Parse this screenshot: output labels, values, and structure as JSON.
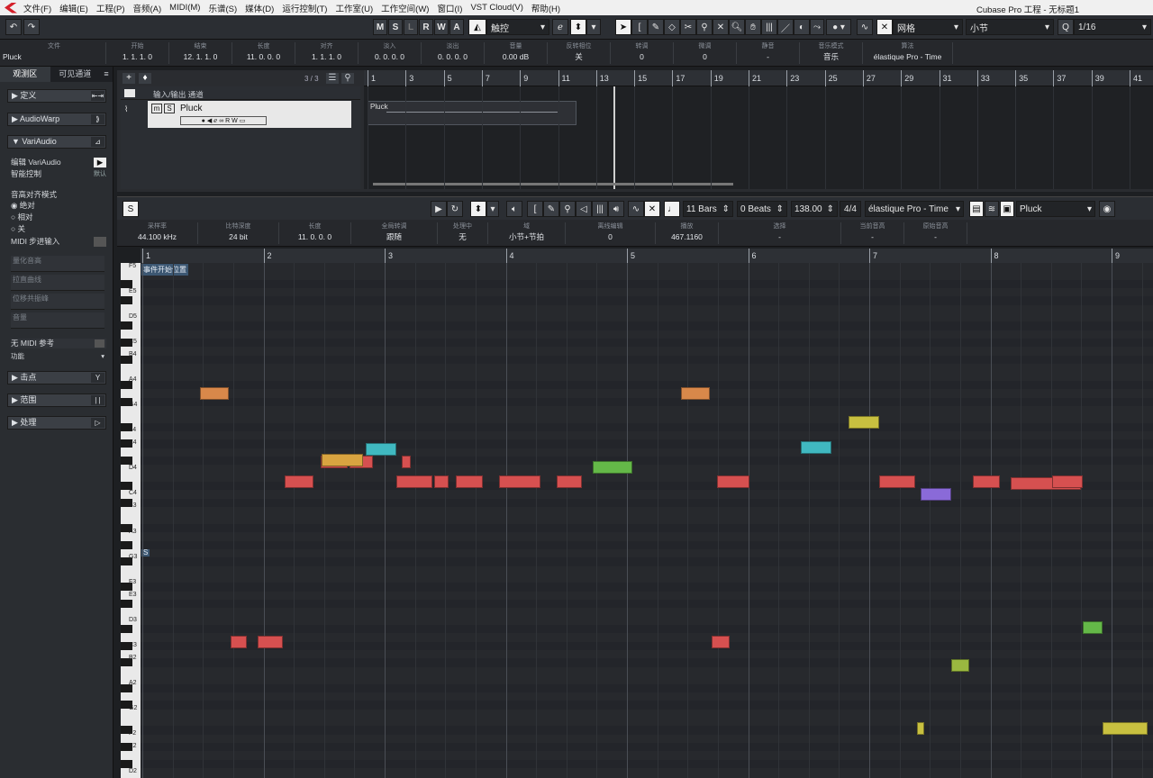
{
  "window_title": "Cubase Pro 工程 - 无标题1",
  "menu": [
    "文件(F)",
    "编辑(E)",
    "工程(P)",
    "音频(A)",
    "MIDI(M)",
    "乐谱(S)",
    "媒体(D)",
    "运行控制(T)",
    "工作室(U)",
    "工作空间(W)",
    "窗口(I)",
    "VST Cloud(V)",
    "帮助(H)"
  ],
  "toolbar": {
    "modes": [
      "M",
      "S",
      "L",
      "R",
      "W",
      "A"
    ],
    "touch_mode": "触控",
    "grid_label": "网格",
    "grid_type": "小节",
    "quantize": "1/16"
  },
  "infoline": {
    "cells": [
      {
        "h": "文件",
        "v": "Pluck"
      },
      {
        "h": "开始",
        "v": "1. 1. 1.   0"
      },
      {
        "h": "结束",
        "v": "12. 1. 1.   0"
      },
      {
        "h": "长度",
        "v": "11. 0. 0.   0"
      },
      {
        "h": "对齐",
        "v": "1. 1. 1.   0"
      },
      {
        "h": "淡入",
        "v": "0. 0. 0.   0"
      },
      {
        "h": "淡出",
        "v": "0. 0. 0.   0"
      },
      {
        "h": "音量",
        "v": "0.00          dB"
      },
      {
        "h": "反转相位",
        "v": "关"
      },
      {
        "h": "转调",
        "v": "0"
      },
      {
        "h": "微调",
        "v": "0"
      },
      {
        "h": "静音",
        "v": "-"
      },
      {
        "h": "音乐模式",
        "v": "音乐"
      },
      {
        "h": "算法",
        "v": "élastique Pro - Time"
      }
    ]
  },
  "inspector": {
    "tabs": [
      "观测区",
      "可见通道"
    ],
    "sections": {
      "define": "定义",
      "audiowarp": "AudioWarp",
      "variaudio": "VariAudio",
      "hitpoints": "击点",
      "range": "范围",
      "process": "处理"
    },
    "edit_variaudio": "编辑 VariAudio",
    "smart_control": "智能控制",
    "smart_default": "默认",
    "pitch_snap_mode": "音高对齐模式",
    "opt_abs": "绝对",
    "opt_rel": "相对",
    "opt_off": "关",
    "midi_step": "MIDI 步进输入",
    "quantize_pitch": "量化音高",
    "straighten": "拉直曲线",
    "formant": "位移共振峰",
    "volume": "音量",
    "no_midi_ref": "无 MIDI 参考",
    "function": "功能"
  },
  "project": {
    "count": "3 / 3",
    "folder_track": "输入/输出 通道",
    "track_name": "Pluck",
    "clip_name": "Pluck",
    "bars": [
      "1",
      "3",
      "5",
      "7",
      "9",
      "11",
      "13",
      "15",
      "17",
      "19",
      "21",
      "23",
      "25",
      "27",
      "29",
      "31",
      "33",
      "35",
      "37",
      "39",
      "41"
    ]
  },
  "sample_editor": {
    "bars_len": "11 Bars",
    "beats": "0 Beats",
    "tempo": "138.00",
    "signature": "4/4",
    "algorithm": "élastique Pro - Time",
    "clip": "Pluck",
    "info": [
      {
        "h": "采样率",
        "v": "44.100          kHz"
      },
      {
        "h": "比特深度",
        "v": "24          bit"
      },
      {
        "h": "长度",
        "v": "11. 0. 0.   0"
      },
      {
        "h": "全局转调",
        "v": "跟随"
      },
      {
        "h": "处理中",
        "v": "无"
      },
      {
        "h": "域",
        "v": "小节+节拍"
      },
      {
        "h": "离线编辑",
        "v": "0"
      },
      {
        "h": "播放",
        "v": "467.1160"
      },
      {
        "h": "选择",
        "v": "-"
      },
      {
        "h": "当前音高",
        "v": "-"
      },
      {
        "h": "原始音高",
        "v": "-"
      }
    ],
    "bars": [
      "1",
      "2",
      "3",
      "4",
      "5",
      "6",
      "7",
      "8",
      "9"
    ],
    "event_start": "事件开始位置",
    "s_marker": "S",
    "keys": [
      "F5",
      "E5",
      "D5",
      "C5",
      "B4",
      "A4",
      "G4",
      "F4",
      "E4",
      "D4",
      "C4",
      "B3",
      "A3",
      "G3",
      "F3",
      "E3",
      "D3",
      "C3",
      "B2",
      "A2",
      "G2",
      "F2",
      "E2",
      "D2"
    ]
  }
}
